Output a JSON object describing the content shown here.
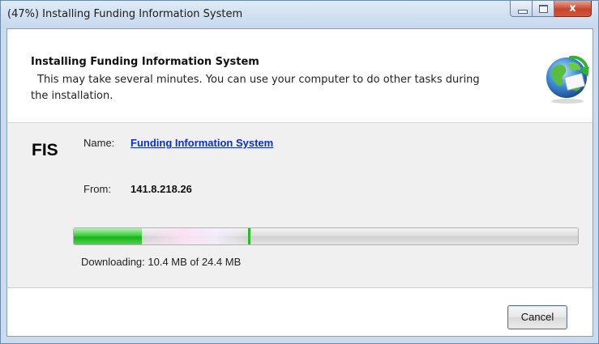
{
  "window": {
    "title": "(47%) Installing Funding Information System",
    "minimize_icon": "minimize-icon",
    "maximize_icon": "maximize-icon",
    "close_icon": "close-icon",
    "close_glyph": "x"
  },
  "header": {
    "title": "Installing Funding Information System",
    "description": "This may take several minutes. You can use your computer to do other tasks during the installation.",
    "icon": "globe-install-icon"
  },
  "app": {
    "logo_text": "FIS",
    "name_label": "Name:",
    "name_value": "Funding Information System",
    "from_label": "From:",
    "from_value": "141.8.218.26"
  },
  "progress": {
    "fill_fraction": 0.135,
    "glow_start_fraction": 0.135,
    "glow_end_fraction": 0.345,
    "marker_fraction": 0.345,
    "status_text": "Downloading: 10.4 MB of 24.4 MB"
  },
  "footer": {
    "cancel_label": "Cancel"
  },
  "colors": {
    "link": "#0b2bd6",
    "progress_green": "#18b418",
    "close_red": "#c6452c"
  }
}
